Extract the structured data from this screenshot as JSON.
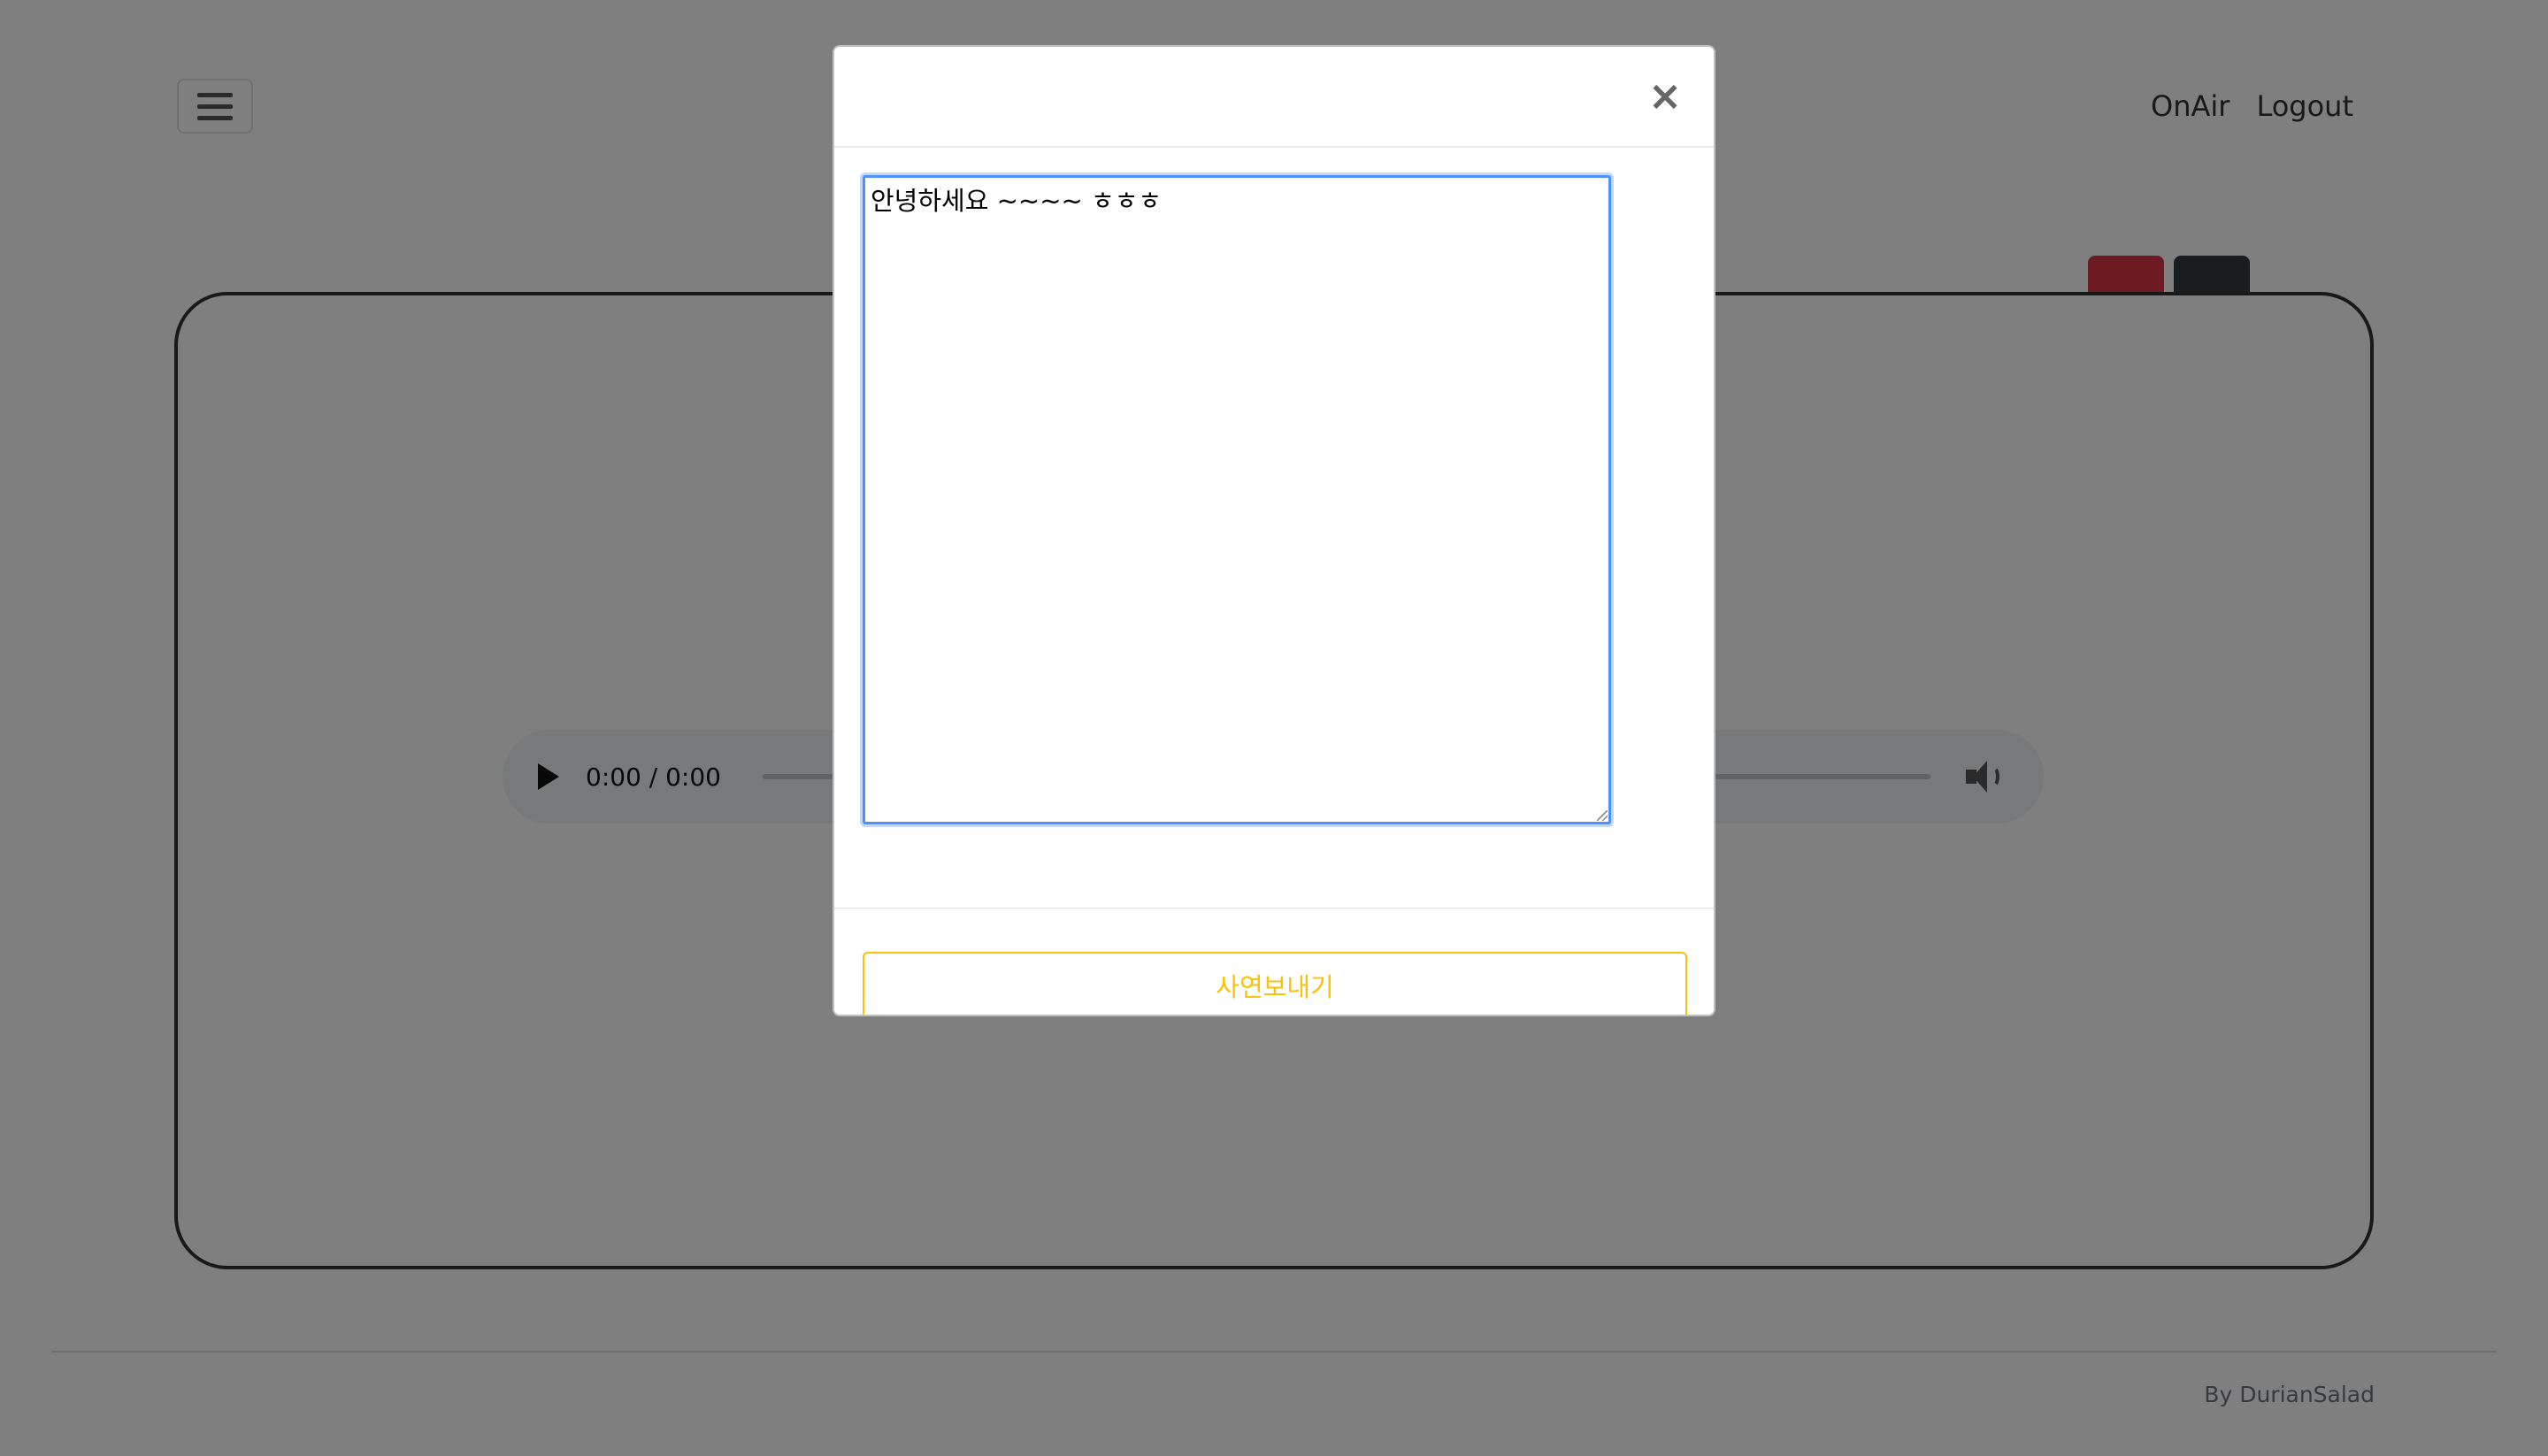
{
  "nav": {
    "menu_icon": "hamburger-menu-icon",
    "links": [
      "OnAir",
      "Logout"
    ]
  },
  "player": {
    "time_display": "0:00 / 0:00",
    "play_icon": "play-icon",
    "volume_icon": "volume-icon",
    "progress": 0
  },
  "side_buttons": {
    "colors": [
      "#dc3545",
      "#343a40"
    ]
  },
  "footer": {
    "credit": "By DurianSalad"
  },
  "modal": {
    "close_label": "×",
    "story_text": "안녕하세요 ~~~~ ㅎㅎㅎ",
    "send_label": "사연보내기",
    "send_color": "#ffc107",
    "focus_color": "#4d90fe"
  }
}
